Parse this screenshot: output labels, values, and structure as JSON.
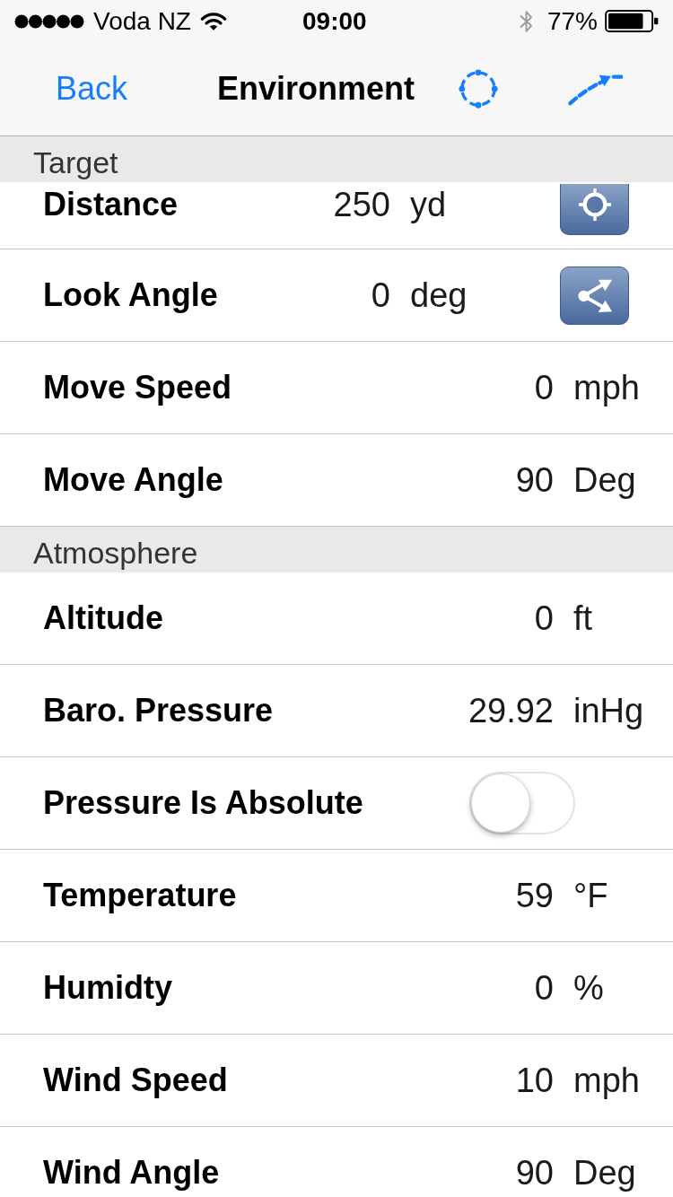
{
  "status_bar": {
    "carrier": "Voda NZ",
    "time": "09:00",
    "battery": "77%"
  },
  "nav_bar": {
    "back": "Back",
    "title": "Environment"
  },
  "sections": [
    {
      "title": "Target",
      "rows": [
        {
          "kind": "ranging",
          "label": "Distance",
          "value": "250",
          "unit": "yd"
        },
        {
          "kind": "angle",
          "label": "Look Angle",
          "value": "0",
          "unit": "deg"
        },
        {
          "kind": "value",
          "label": "Move Speed",
          "value": "0",
          "unit": "mph"
        },
        {
          "kind": "value",
          "label": "Move Angle",
          "value": "90",
          "unit": "Deg"
        }
      ]
    },
    {
      "title": "Atmosphere",
      "rows": [
        {
          "kind": "value",
          "label": "Altitude",
          "value": "0",
          "unit": "ft"
        },
        {
          "kind": "value",
          "label": "Baro. Pressure",
          "value": "29.92",
          "unit": "inHg"
        },
        {
          "kind": "switch",
          "label": "Pressure Is Absolute",
          "on": false
        },
        {
          "kind": "value",
          "label": "Temperature",
          "value": "59",
          "unit": "°F"
        },
        {
          "kind": "value",
          "label": "Humidty",
          "value": "0",
          "unit": "%"
        },
        {
          "kind": "value",
          "label": "Wind Speed",
          "value": "10",
          "unit": "mph"
        },
        {
          "kind": "value",
          "label": "Wind Angle",
          "value": "90",
          "unit": "Deg"
        }
      ]
    }
  ]
}
